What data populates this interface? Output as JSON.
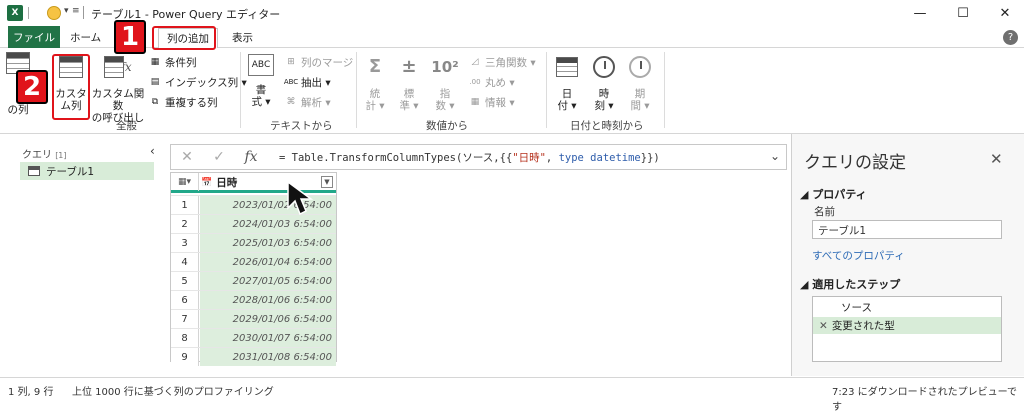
{
  "titlebar": {
    "app_logo": "X",
    "title": "テーブル1 - Power Query エディター",
    "minimize_icon": "—",
    "maximize_icon": "☐",
    "close_icon": "✕"
  },
  "tabs": {
    "file": "ファイル",
    "home": "ホーム",
    "add_column": "列の追加",
    "view": "表示"
  },
  "callouts": {
    "badge1": "1",
    "badge2": "2",
    "color": "#e0141b"
  },
  "ribbon": {
    "example_cols_short": "の列",
    "custom_col_line1": "カスタ",
    "custom_col_line2": "ム列",
    "invoke_fn_line1": "カスタム関数",
    "invoke_fn_line2": "の呼び出し",
    "conditional": "条件列",
    "index": "インデックス列 ▾",
    "duplicate": "重複する列",
    "general_group": "全般",
    "format_line1": "書",
    "format_line2": "式 ▾",
    "merge_cols": "列のマージ",
    "extract": "抽出 ▾",
    "parse": "解析 ▾",
    "text_group": "テキストから",
    "stats_line1": "統",
    "stats_line2": "計 ▾",
    "standard_line1": "標",
    "standard_line2": "準 ▾",
    "scientific_line1": "指",
    "scientific_line2": "数 ▾",
    "trig": "三角関数 ▾",
    "rounding": "丸め ▾",
    "info": "情報 ▾",
    "number_group": "数値から",
    "date_line1": "日",
    "date_line2": "付 ▾",
    "time_line1": "時",
    "time_line2": "刻 ▾",
    "duration_line1": "期",
    "duration_line2": "間 ▾",
    "datetime_group": "日付と時刻から"
  },
  "queries": {
    "header": "クエリ",
    "count": "[1]",
    "items": [
      "テーブル1"
    ]
  },
  "formula": {
    "cancel_icon": "✕",
    "confirm_icon": "✓",
    "fx": "fx",
    "p1": "= Table.TransformColumnTypes(ソース,{{",
    "p2": "\"日時\"",
    "p3": ", ",
    "p4": "type datetime",
    "p5": "}})"
  },
  "grid": {
    "column_header": "日時",
    "rows": [
      {
        "n": "1",
        "v": "2023/01/02 6:54:00"
      },
      {
        "n": "2",
        "v": "2024/01/03 6:54:00"
      },
      {
        "n": "3",
        "v": "2025/01/03 6:54:00"
      },
      {
        "n": "4",
        "v": "2026/01/04 6:54:00"
      },
      {
        "n": "5",
        "v": "2027/01/05 6:54:00"
      },
      {
        "n": "6",
        "v": "2028/01/06 6:54:00"
      },
      {
        "n": "7",
        "v": "2029/01/06 6:54:00"
      },
      {
        "n": "8",
        "v": "2030/01/07 6:54:00"
      },
      {
        "n": "9",
        "v": "2031/01/08 6:54:00"
      }
    ]
  },
  "settings": {
    "title": "クエリの設定",
    "properties": "プロパティ",
    "name_label": "名前",
    "name_value": "テーブル1",
    "all_props": "すべてのプロパティ",
    "applied_steps": "適用したステップ",
    "steps": [
      "ソース",
      "変更された型"
    ]
  },
  "status": {
    "left1": "1 列, 9 行",
    "left2": "上位 1000 行に基づく列のプロファイリング",
    "right": "7:23 にダウンロードされたプレビューです"
  }
}
